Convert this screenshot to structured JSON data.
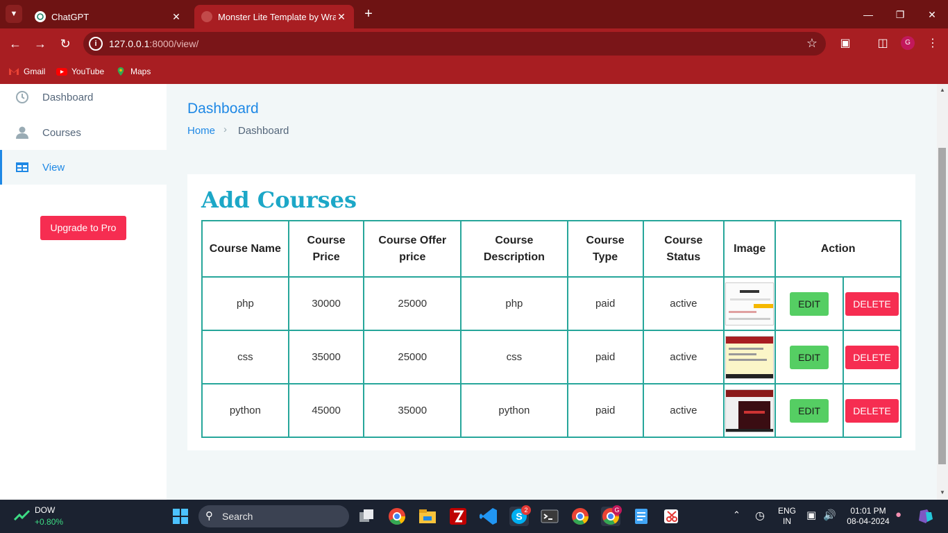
{
  "browser": {
    "tabs": [
      {
        "title": "ChatGPT",
        "active": false
      },
      {
        "title": "Monster Lite Template by Wrap",
        "active": true
      }
    ],
    "url_host": "127.0.0.1",
    "url_path": ":8000/view/",
    "profile_initial": "G",
    "bookmarks": [
      "Gmail",
      "YouTube",
      "Maps"
    ]
  },
  "sidebar": {
    "items": [
      {
        "label": "Dashboard",
        "icon": "clock-icon"
      },
      {
        "label": "Courses",
        "icon": "user-icon"
      },
      {
        "label": "View",
        "icon": "table-icon"
      }
    ],
    "upgrade_label": "Upgrade to Pro"
  },
  "page": {
    "title": "Dashboard",
    "breadcrumb_home": "Home",
    "breadcrumb_current": "Dashboard"
  },
  "card": {
    "title": "Add Courses",
    "headers": [
      "Course Name",
      "Course Price",
      "Course Offer price",
      "Course Description",
      "Course Type",
      "Course Status",
      "Image",
      "Action"
    ],
    "rows": [
      {
        "name": "php",
        "price": "30000",
        "offer": "25000",
        "description": "php",
        "type": "paid",
        "status": "active"
      },
      {
        "name": "css",
        "price": "35000",
        "offer": "25000",
        "description": "css",
        "type": "paid",
        "status": "active"
      },
      {
        "name": "python",
        "price": "45000",
        "offer": "35000",
        "description": "python",
        "type": "paid",
        "status": "active"
      }
    ],
    "edit_label": "EDIT",
    "delete_label": "DELETE"
  },
  "taskbar": {
    "stock_name": "DOW",
    "stock_change": "+0.80%",
    "search_label": "Search",
    "skype_badge": "2",
    "chrome_badge": "G",
    "lang": "ENG",
    "region": "IN",
    "time": "01:01 PM",
    "date": "08-04-2024"
  },
  "colors": {
    "chrome_dark": "#6e1313",
    "chrome": "#a81e22",
    "accent": "#1e88e5",
    "table_border": "#26a69a",
    "edit": "#55ce63",
    "delete": "#f62d51"
  }
}
